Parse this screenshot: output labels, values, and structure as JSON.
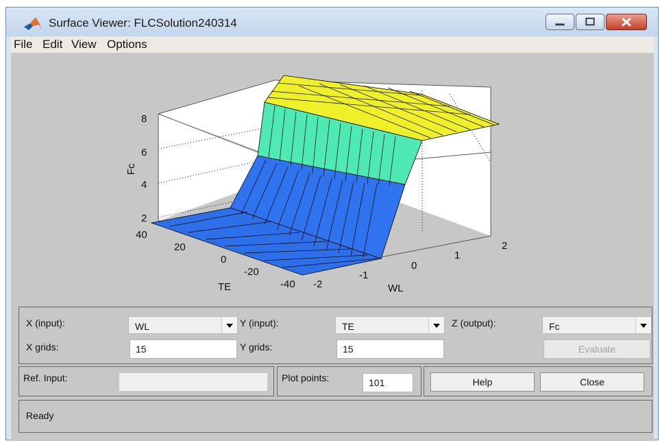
{
  "window": {
    "title": "Surface Viewer: FLCSolution240314"
  },
  "menu": [
    "File",
    "Edit",
    "View",
    "Options"
  ],
  "plot": {
    "z_label": "Fc",
    "x_label": "WL",
    "y_label": "TE",
    "z_ticks": [
      "8",
      "6",
      "4",
      "2"
    ],
    "x_ticks": [
      "-2",
      "-1",
      "0",
      "1",
      "2"
    ],
    "y_ticks": [
      "40",
      "20",
      "0",
      "-20",
      "-40"
    ],
    "colors": {
      "low": "#2d6fe8",
      "mid": "#4fe9b3",
      "high": "#f0f02a"
    }
  },
  "controls": {
    "x_input_label": "X (input):",
    "x_input_value": "WL",
    "y_input_label": "Y (input):",
    "y_input_value": "TE",
    "z_output_label": "Z (output):",
    "z_output_value": "Fc",
    "x_grids_label": "X grids:",
    "x_grids_value": "15",
    "y_grids_label": "Y grids:",
    "y_grids_value": "15",
    "evaluate_label": "Evaluate",
    "ref_input_label": "Ref. Input:",
    "ref_input_value": "",
    "plot_points_label": "Plot points:",
    "plot_points_value": "101",
    "help_label": "Help",
    "close_label": "Close"
  },
  "status": "Ready"
}
